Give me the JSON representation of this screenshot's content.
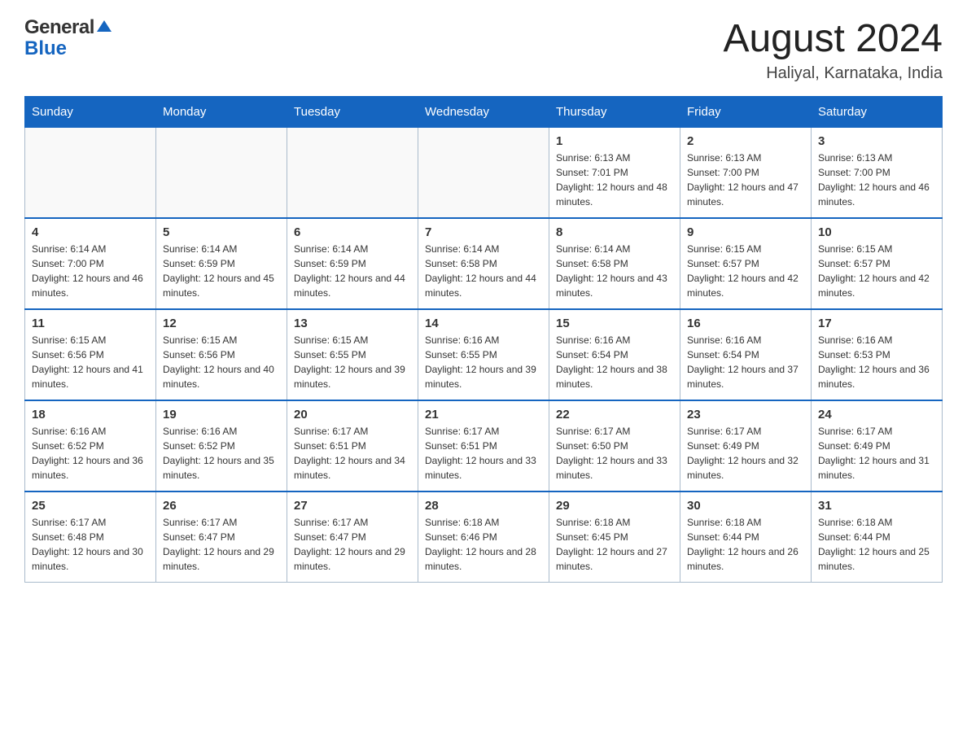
{
  "header": {
    "logo_general": "General",
    "logo_blue": "Blue",
    "title": "August 2024",
    "subtitle": "Haliyal, Karnataka, India"
  },
  "days_of_week": [
    "Sunday",
    "Monday",
    "Tuesday",
    "Wednesday",
    "Thursday",
    "Friday",
    "Saturday"
  ],
  "weeks": [
    [
      {
        "day": "",
        "info": ""
      },
      {
        "day": "",
        "info": ""
      },
      {
        "day": "",
        "info": ""
      },
      {
        "day": "",
        "info": ""
      },
      {
        "day": "1",
        "info": "Sunrise: 6:13 AM\nSunset: 7:01 PM\nDaylight: 12 hours and 48 minutes."
      },
      {
        "day": "2",
        "info": "Sunrise: 6:13 AM\nSunset: 7:00 PM\nDaylight: 12 hours and 47 minutes."
      },
      {
        "day": "3",
        "info": "Sunrise: 6:13 AM\nSunset: 7:00 PM\nDaylight: 12 hours and 46 minutes."
      }
    ],
    [
      {
        "day": "4",
        "info": "Sunrise: 6:14 AM\nSunset: 7:00 PM\nDaylight: 12 hours and 46 minutes."
      },
      {
        "day": "5",
        "info": "Sunrise: 6:14 AM\nSunset: 6:59 PM\nDaylight: 12 hours and 45 minutes."
      },
      {
        "day": "6",
        "info": "Sunrise: 6:14 AM\nSunset: 6:59 PM\nDaylight: 12 hours and 44 minutes."
      },
      {
        "day": "7",
        "info": "Sunrise: 6:14 AM\nSunset: 6:58 PM\nDaylight: 12 hours and 44 minutes."
      },
      {
        "day": "8",
        "info": "Sunrise: 6:14 AM\nSunset: 6:58 PM\nDaylight: 12 hours and 43 minutes."
      },
      {
        "day": "9",
        "info": "Sunrise: 6:15 AM\nSunset: 6:57 PM\nDaylight: 12 hours and 42 minutes."
      },
      {
        "day": "10",
        "info": "Sunrise: 6:15 AM\nSunset: 6:57 PM\nDaylight: 12 hours and 42 minutes."
      }
    ],
    [
      {
        "day": "11",
        "info": "Sunrise: 6:15 AM\nSunset: 6:56 PM\nDaylight: 12 hours and 41 minutes."
      },
      {
        "day": "12",
        "info": "Sunrise: 6:15 AM\nSunset: 6:56 PM\nDaylight: 12 hours and 40 minutes."
      },
      {
        "day": "13",
        "info": "Sunrise: 6:15 AM\nSunset: 6:55 PM\nDaylight: 12 hours and 39 minutes."
      },
      {
        "day": "14",
        "info": "Sunrise: 6:16 AM\nSunset: 6:55 PM\nDaylight: 12 hours and 39 minutes."
      },
      {
        "day": "15",
        "info": "Sunrise: 6:16 AM\nSunset: 6:54 PM\nDaylight: 12 hours and 38 minutes."
      },
      {
        "day": "16",
        "info": "Sunrise: 6:16 AM\nSunset: 6:54 PM\nDaylight: 12 hours and 37 minutes."
      },
      {
        "day": "17",
        "info": "Sunrise: 6:16 AM\nSunset: 6:53 PM\nDaylight: 12 hours and 36 minutes."
      }
    ],
    [
      {
        "day": "18",
        "info": "Sunrise: 6:16 AM\nSunset: 6:52 PM\nDaylight: 12 hours and 36 minutes."
      },
      {
        "day": "19",
        "info": "Sunrise: 6:16 AM\nSunset: 6:52 PM\nDaylight: 12 hours and 35 minutes."
      },
      {
        "day": "20",
        "info": "Sunrise: 6:17 AM\nSunset: 6:51 PM\nDaylight: 12 hours and 34 minutes."
      },
      {
        "day": "21",
        "info": "Sunrise: 6:17 AM\nSunset: 6:51 PM\nDaylight: 12 hours and 33 minutes."
      },
      {
        "day": "22",
        "info": "Sunrise: 6:17 AM\nSunset: 6:50 PM\nDaylight: 12 hours and 33 minutes."
      },
      {
        "day": "23",
        "info": "Sunrise: 6:17 AM\nSunset: 6:49 PM\nDaylight: 12 hours and 32 minutes."
      },
      {
        "day": "24",
        "info": "Sunrise: 6:17 AM\nSunset: 6:49 PM\nDaylight: 12 hours and 31 minutes."
      }
    ],
    [
      {
        "day": "25",
        "info": "Sunrise: 6:17 AM\nSunset: 6:48 PM\nDaylight: 12 hours and 30 minutes."
      },
      {
        "day": "26",
        "info": "Sunrise: 6:17 AM\nSunset: 6:47 PM\nDaylight: 12 hours and 29 minutes."
      },
      {
        "day": "27",
        "info": "Sunrise: 6:17 AM\nSunset: 6:47 PM\nDaylight: 12 hours and 29 minutes."
      },
      {
        "day": "28",
        "info": "Sunrise: 6:18 AM\nSunset: 6:46 PM\nDaylight: 12 hours and 28 minutes."
      },
      {
        "day": "29",
        "info": "Sunrise: 6:18 AM\nSunset: 6:45 PM\nDaylight: 12 hours and 27 minutes."
      },
      {
        "day": "30",
        "info": "Sunrise: 6:18 AM\nSunset: 6:44 PM\nDaylight: 12 hours and 26 minutes."
      },
      {
        "day": "31",
        "info": "Sunrise: 6:18 AM\nSunset: 6:44 PM\nDaylight: 12 hours and 25 minutes."
      }
    ]
  ]
}
